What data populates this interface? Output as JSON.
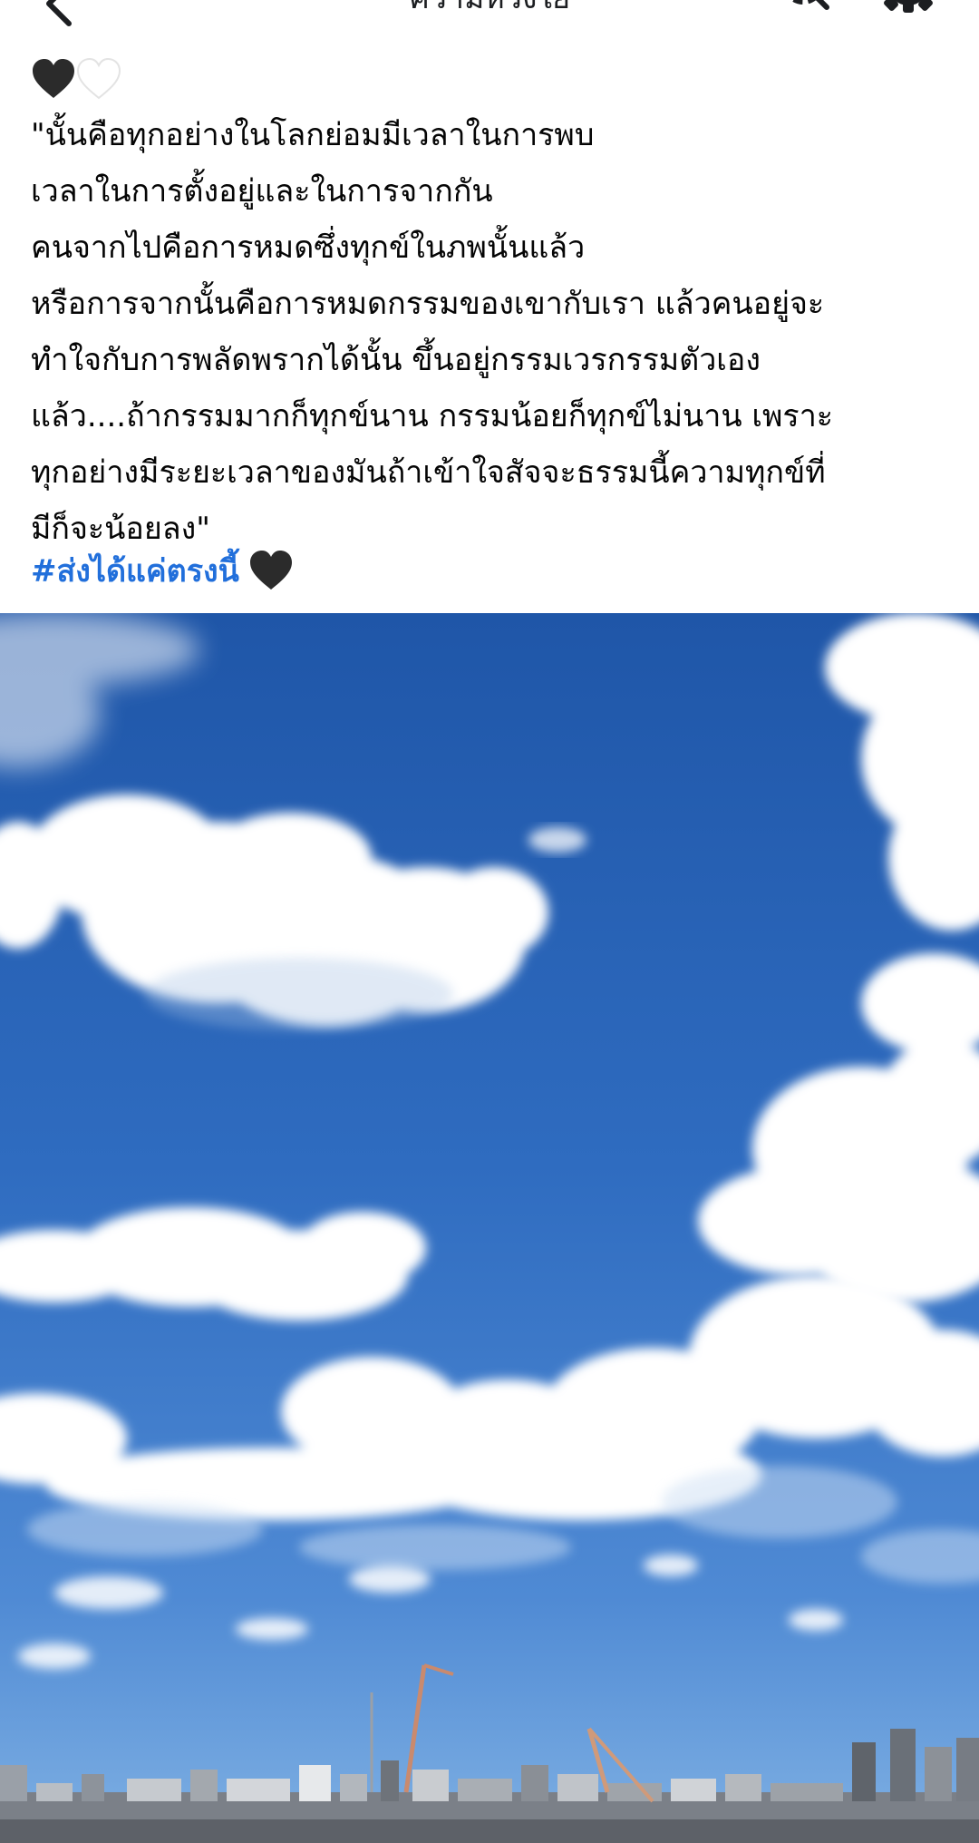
{
  "app_bar": {
    "title": "ความห่วงใย",
    "back_icon": "chevron-left-icon",
    "search_icon": "search-icon",
    "settings_icon": "gear-icon"
  },
  "post": {
    "leading_emoji": [
      "black-heart-icon",
      "white-heart-icon"
    ],
    "text_lines": [
      "\"นั้นคือทุกอย่างในโลกย่อมมีเวลาในการพบ",
      "เวลาในการตั้งอยู่และในการจากกัน",
      "คนจากไปคือการหมดซึ่งทุกข์ในภพนั้นแล้ว",
      "หรือการจากนั้นคือการหมดกรรมของเขากับเรา แล้วคนอยู่จะ",
      "ทำใจกับการพลัดพรากได้นั้น ขึ้นอยู่กรรมเวรกรรมตัวเอง",
      "แล้ว....ถ้ากรรมมากก็ทุกข์นาน กรรมน้อยก็ทุกข์ไม่นาน เพราะ",
      "ทุกอย่างมีระยะเวลาของมันถ้าเข้าใจสัจจะธรรมนี้ความทุกข์ที่",
      "มีก็จะน้อยลง\""
    ],
    "hashtag": "#ส่งได้แค่ตรงนี้",
    "trailing_emoji": "black-heart-icon"
  },
  "photo": {
    "subject": "blue-sky-clouds-city-skyline-photo",
    "colors": {
      "sky_top": "#1f5bb0",
      "sky_mid": "#3d7bcd",
      "sky_low": "#6aa2df",
      "cloud": "#ffffff",
      "city": "#8a8f96"
    }
  },
  "colors": {
    "text": "#050505",
    "link": "#216fdb",
    "divider": "#e6e6e6"
  }
}
